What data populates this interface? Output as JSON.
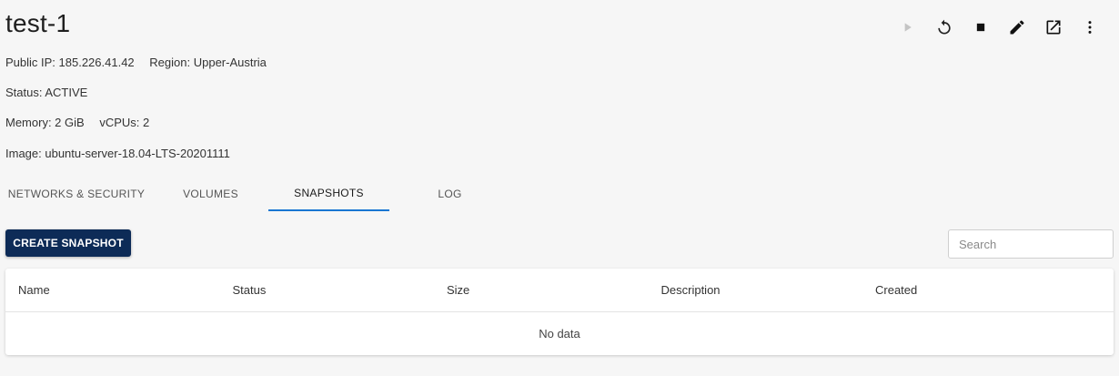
{
  "instance": {
    "name": "test-1",
    "public_ip_label": "Public IP: 185.226.41.42",
    "region_label": "Region: Upper-Austria",
    "status_label": "Status: ACTIVE",
    "memory_label": "Memory: 2 GiB",
    "vcpus_label": "vCPUs: 2",
    "image_label": "Image: ubuntu-server-18.04-LTS-20201111"
  },
  "actions": [
    {
      "icon": "play-icon",
      "disabled": true
    },
    {
      "icon": "restart-icon"
    },
    {
      "icon": "stop-icon"
    },
    {
      "icon": "edit-icon"
    },
    {
      "icon": "open-external-icon"
    },
    {
      "icon": "more-vert-icon"
    }
  ],
  "tabs": [
    {
      "label": "NETWORKS & SECURITY",
      "active": false
    },
    {
      "label": "VOLUMES",
      "active": false
    },
    {
      "label": "SNAPSHOTS",
      "active": true
    },
    {
      "label": "LOG",
      "active": false
    }
  ],
  "toolbar": {
    "create_label": "CREATE SNAPSHOT",
    "search_placeholder": "Search"
  },
  "table": {
    "columns": [
      "Name",
      "Status",
      "Size",
      "Description",
      "Created"
    ],
    "empty_text": "No data"
  },
  "colors": {
    "accent": "#1976d2",
    "primary_button": "#0d2b57",
    "background": "#f6f6f6"
  }
}
